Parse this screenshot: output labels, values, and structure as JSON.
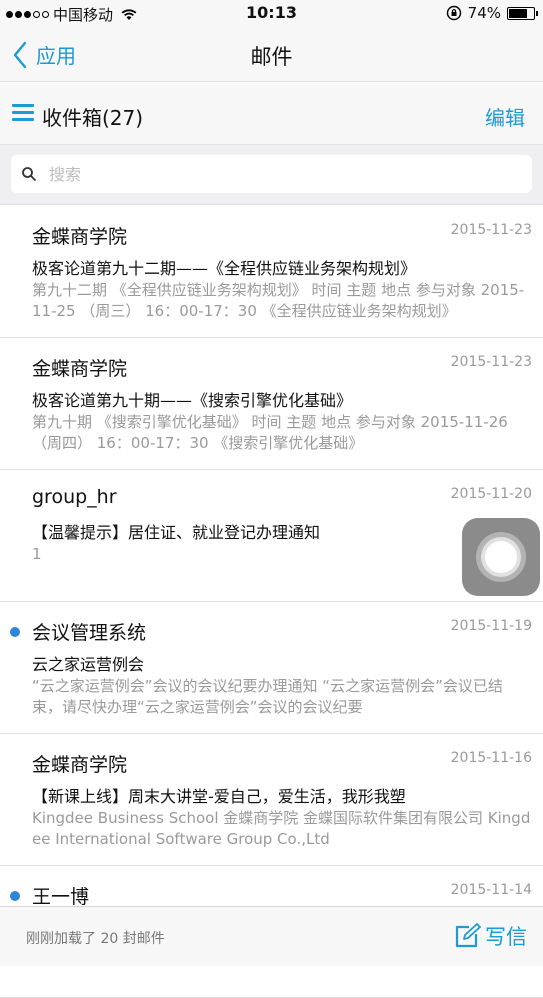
{
  "status_bar": {
    "carrier": "中国移动",
    "time": "10:13",
    "battery": "74%",
    "battery_level": 0.74
  },
  "nav": {
    "back_label": "应用",
    "title": "邮件"
  },
  "inbox": {
    "title": "收件箱(27)",
    "edit_label": "编辑"
  },
  "search": {
    "placeholder": "搜索"
  },
  "mails": [
    {
      "sender": "金蝶商学院",
      "date": "2015-11-23",
      "subject": "极客论道第九十二期——《全程供应链业务架构规划》",
      "preview": "第九十二期 《全程供应链业务架构规划》 时间 主题 地点 参与对象 2015-11-25 （周三） 16：00-17：30 《全程供应链业务架构规划》",
      "unread": false
    },
    {
      "sender": "金蝶商学院",
      "date": "2015-11-23",
      "subject": "极客论道第九十期——《搜索引擎优化基础》",
      "preview": "第九十期 《搜索引擎优化基础》 时间 主题 地点 参与对象 2015-11-26 （周四） 16：00-17：30 《搜索引擎优化基础》",
      "unread": false
    },
    {
      "sender": "group_hr",
      "date": "2015-11-20",
      "subject": "【温馨提示】居住证、就业登记办理通知",
      "preview": "1",
      "unread": false
    },
    {
      "sender": "会议管理系统",
      "date": "2015-11-19",
      "subject": "云之家运营例会",
      "preview": "“云之家运营例会”会议的会议纪要办理通知 “云之家运营例会”会议已结束，请尽快办理“云之家运营例会”会议的会议纪要",
      "unread": true
    },
    {
      "sender": "金蝶商学院",
      "date": "2015-11-16",
      "subject": "【新课上线】周末大讲堂-爱自己，爱生活，我形我塑",
      "preview": "Kingdee Business School 金蝶商学院 金蝶国际软件集团有限公司 Kingdee International Software Group Co.,Ltd",
      "unread": false
    },
    {
      "sender": "王一博",
      "date": "2015-11-14",
      "subject": "",
      "preview": "",
      "unread": true
    }
  ],
  "footer": {
    "status": "刚刚加载了 20 封邮件",
    "compose_label": "写信"
  },
  "icons": {
    "back": "chevron-left-icon",
    "menu": "hamburger-menu-icon",
    "search": "search-icon",
    "compose": "compose-icon",
    "assistive": "assistive-touch-icon"
  },
  "colors": {
    "accent": "#1b9ad6",
    "unread_dot": "#2f86d6"
  }
}
